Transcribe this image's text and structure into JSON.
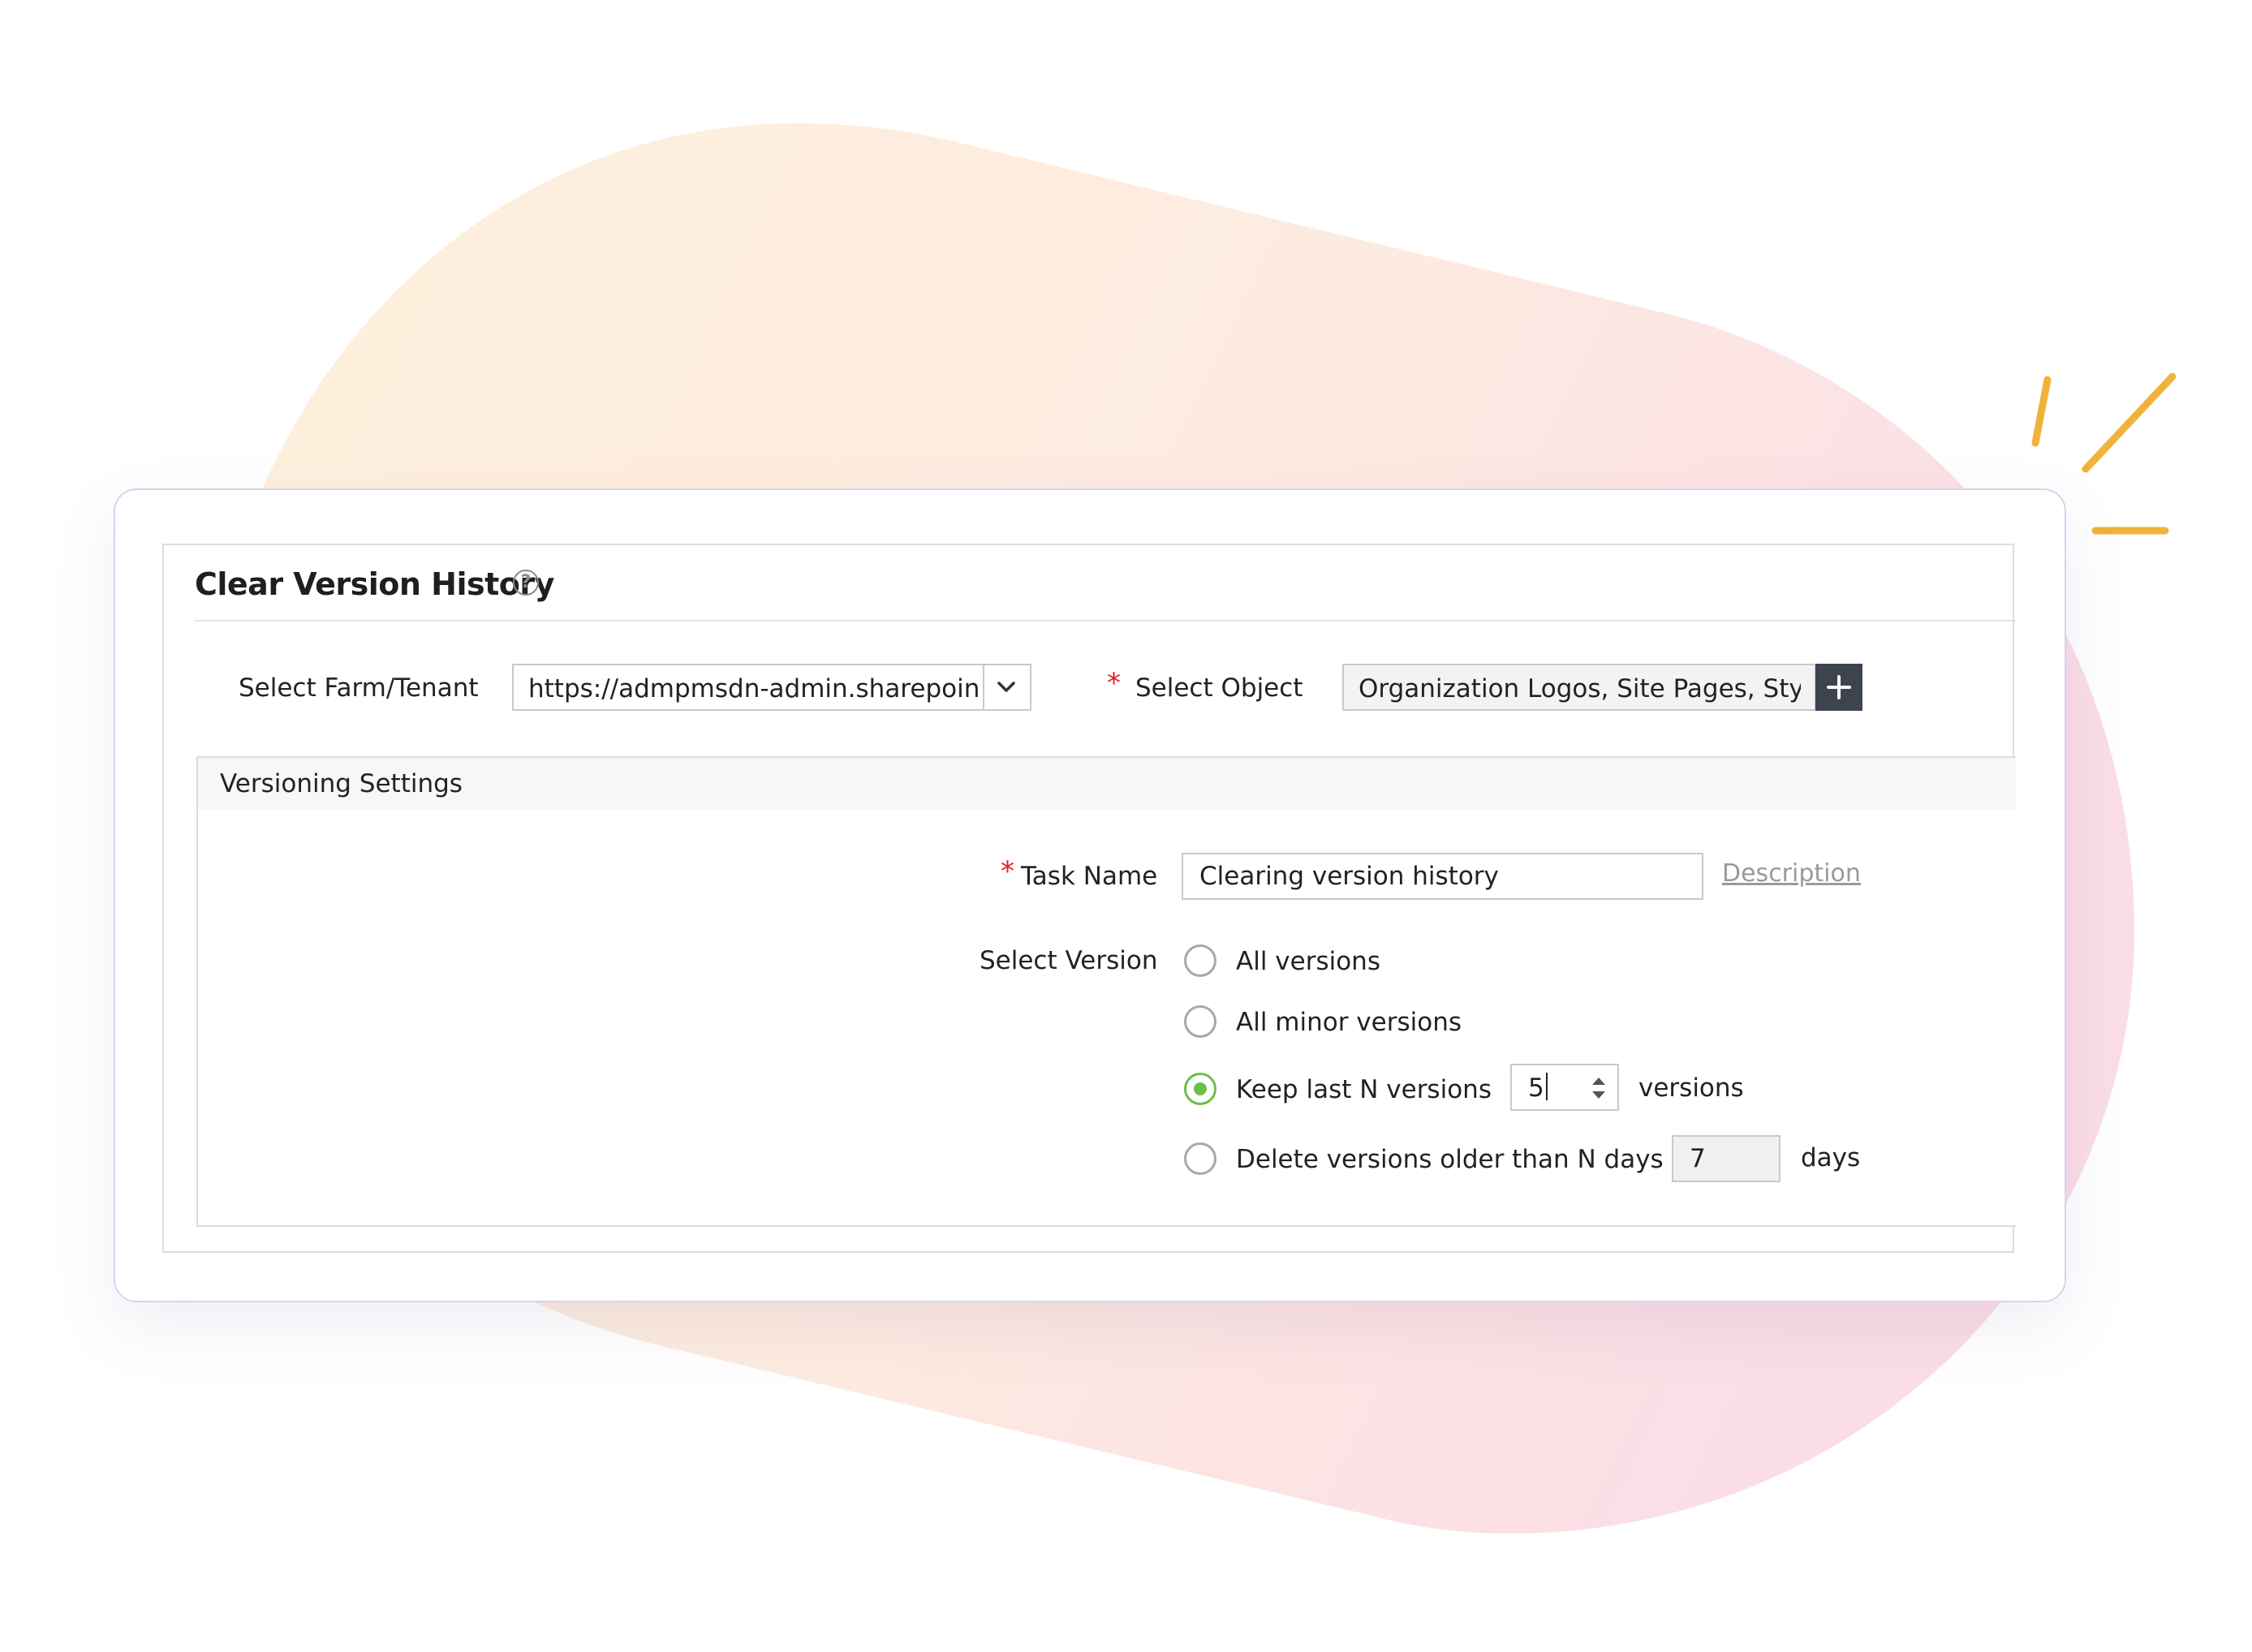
{
  "panel": {
    "title": "Clear Version History",
    "help_icon": "help-circle-icon"
  },
  "farm": {
    "label": "Select Farm/Tenant",
    "value": "https://admpmsdn-admin.sharepoint",
    "dropdown_icon": "chevron-down-icon"
  },
  "object": {
    "required_mark": "*",
    "label": "Select Object",
    "value": "Organization Logos, Site Pages, Style",
    "add_icon": "plus-icon"
  },
  "versioning": {
    "section_title": "Versioning Settings",
    "task_name": {
      "required_mark": "*",
      "label": "Task Name",
      "value": "Clearing version history",
      "description_link": "Description"
    },
    "select_version": {
      "label": "Select Version",
      "options": [
        {
          "label": "All versions",
          "checked": false
        },
        {
          "label": "All minor versions",
          "checked": false
        },
        {
          "label": "Keep last N versions",
          "checked": true,
          "input_value": "5",
          "suffix": "versions"
        },
        {
          "label": "Delete versions older than N days",
          "checked": false,
          "input_value": "7",
          "suffix": "days"
        }
      ]
    }
  },
  "colors": {
    "accent_green": "#6bbf4a",
    "required_red": "#e02020",
    "add_button": "#3d4450",
    "card_border": "#d8d2f3",
    "spark": "#f0b23a"
  }
}
